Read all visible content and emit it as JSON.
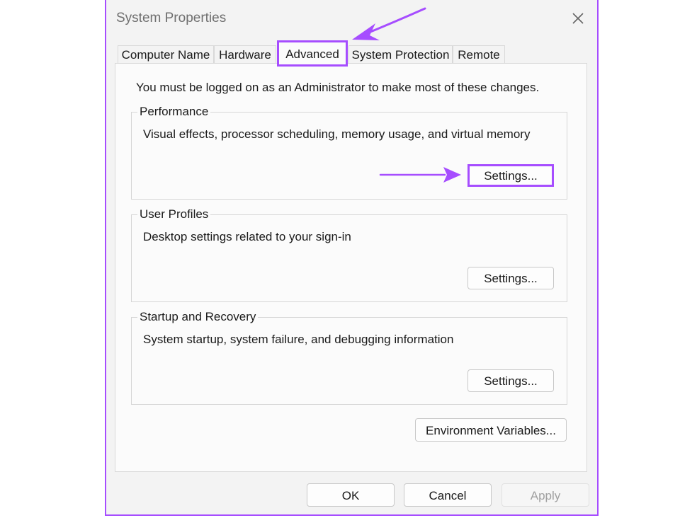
{
  "window": {
    "title": "System Properties"
  },
  "tabs": [
    {
      "label": "Computer Name",
      "active": false
    },
    {
      "label": "Hardware",
      "active": false
    },
    {
      "label": "Advanced",
      "active": true
    },
    {
      "label": "System Protection",
      "active": false
    },
    {
      "label": "Remote",
      "active": false
    }
  ],
  "intro_text": "You must be logged on as an Administrator to make most of these changes.",
  "groups": {
    "performance": {
      "label": "Performance",
      "description": "Visual effects, processor scheduling, memory usage, and virtual memory",
      "button": "Settings..."
    },
    "user_profiles": {
      "label": "User Profiles",
      "description": "Desktop settings related to your sign-in",
      "button": "Settings..."
    },
    "startup_recovery": {
      "label": "Startup and Recovery",
      "description": "System startup, system failure, and debugging information",
      "button": "Settings..."
    }
  },
  "env_button": "Environment Variables...",
  "footer": {
    "ok": "OK",
    "cancel": "Cancel",
    "apply": "Apply",
    "apply_enabled": false
  },
  "icons": {
    "close": "close-icon",
    "arrow": "arrow-icon"
  },
  "colors": {
    "highlight": "#a64dff",
    "dialog_bg": "#f3f3f3",
    "panel_bg": "#fbfbfb"
  }
}
